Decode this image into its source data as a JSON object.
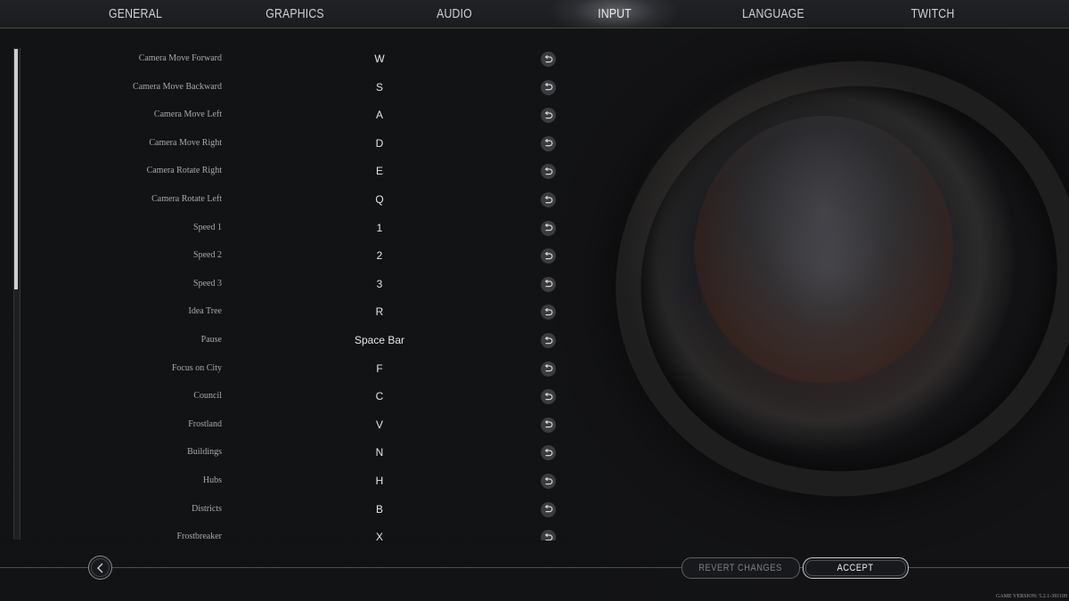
{
  "tabs": [
    {
      "label": "GENERAL",
      "active": false
    },
    {
      "label": "GRAPHICS",
      "active": false
    },
    {
      "label": "AUDIO",
      "active": false
    },
    {
      "label": "INPUT",
      "active": true
    },
    {
      "label": "LANGUAGE",
      "active": false
    },
    {
      "label": "TWITCH",
      "active": false
    }
  ],
  "keybinds": [
    {
      "action": "Camera Move Forward",
      "key": "W"
    },
    {
      "action": "Camera Move Backward",
      "key": "S"
    },
    {
      "action": "Camera Move Left",
      "key": "A"
    },
    {
      "action": "Camera Move Right",
      "key": "D"
    },
    {
      "action": "Camera Rotate Right",
      "key": "E"
    },
    {
      "action": "Camera Rotate Left",
      "key": "Q"
    },
    {
      "action": "Speed 1",
      "key": "1"
    },
    {
      "action": "Speed 2",
      "key": "2"
    },
    {
      "action": "Speed 3",
      "key": "3"
    },
    {
      "action": "Idea Tree",
      "key": "R"
    },
    {
      "action": "Pause",
      "key": "Space Bar"
    },
    {
      "action": "Focus on City",
      "key": "F"
    },
    {
      "action": "Council",
      "key": "C"
    },
    {
      "action": "Frostland",
      "key": "V"
    },
    {
      "action": "Buildings",
      "key": "N"
    },
    {
      "action": "Hubs",
      "key": "H"
    },
    {
      "action": "Districts",
      "key": "B"
    },
    {
      "action": "Frostbreaker",
      "key": "X"
    }
  ],
  "icons": {
    "reset": "undo-arrow-icon",
    "back": "chevron-left-icon"
  },
  "scroll": {
    "position_fraction": 0.0,
    "visible_fraction": 0.49
  },
  "footer": {
    "revert_label": "REVERT CHANGES",
    "accept_label": "ACCEPT",
    "version": "GAME VERSION: 5.2.1-391109"
  }
}
